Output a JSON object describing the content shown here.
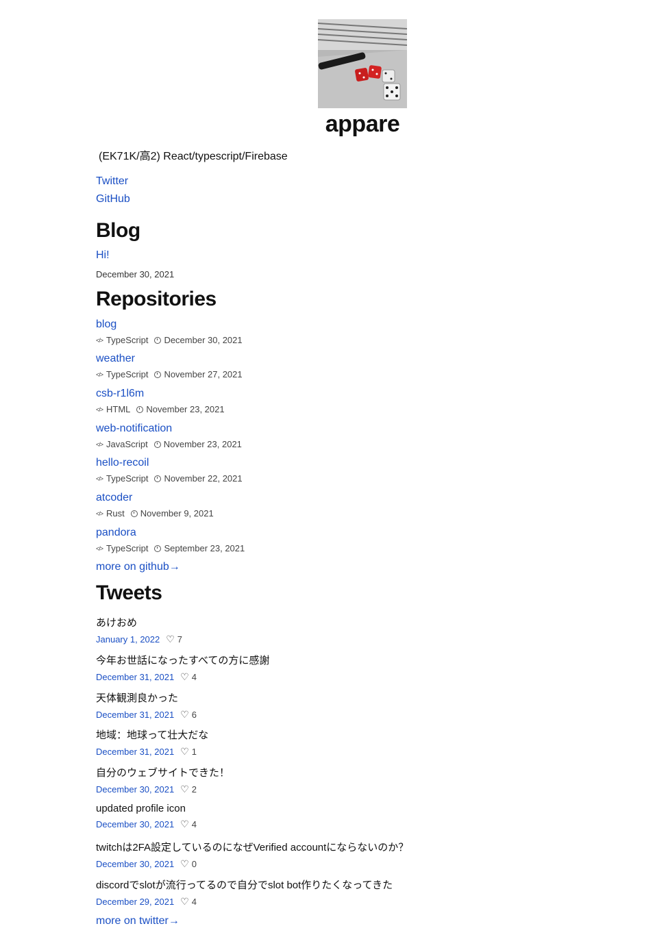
{
  "profile": {
    "name": "appare",
    "bio": "(EK71K/高2) React/typescript/Firebase",
    "links": [
      {
        "label": "Twitter"
      },
      {
        "label": "GitHub"
      }
    ]
  },
  "blog": {
    "heading": "Blog",
    "posts": [
      {
        "title": "Hi!",
        "date": "December 30, 2021"
      }
    ]
  },
  "repositories": {
    "heading": "Repositories",
    "items": [
      {
        "name": "blog",
        "language": "TypeScript",
        "date": "December 30, 2021"
      },
      {
        "name": "weather",
        "language": "TypeScript",
        "date": "November 27, 2021"
      },
      {
        "name": "csb-r1l6m",
        "language": "HTML",
        "date": "November 23, 2021"
      },
      {
        "name": "web-notification",
        "language": "JavaScript",
        "date": "November 23, 2021"
      },
      {
        "name": "hello-recoil",
        "language": "TypeScript",
        "date": "November 22, 2021"
      },
      {
        "name": "atcoder",
        "language": "Rust",
        "date": "November 9, 2021"
      },
      {
        "name": "pandora",
        "language": "TypeScript",
        "date": "September 23, 2021"
      }
    ],
    "more_label": "more on github→"
  },
  "tweets": {
    "heading": "Tweets",
    "items": [
      {
        "text": "あけおめ",
        "date": "January 1, 2022",
        "likes": "7"
      },
      {
        "text": "今年お世話になったすべての方に感謝",
        "date": "December 31, 2021",
        "likes": "4"
      },
      {
        "text": "天体観測良かった",
        "date": "December 31, 2021",
        "likes": "6"
      },
      {
        "text": "地域：地球って壮大だな",
        "date": "December 31, 2021",
        "likes": "1"
      },
      {
        "text": "自分のウェブサイトできた！",
        "date": "December 30, 2021",
        "likes": "2"
      },
      {
        "text": "updated profile icon",
        "date": "December 30, 2021",
        "likes": "4"
      },
      {
        "text": "twitchは2FA設定しているのになぜVerified accountにならないのか？",
        "date": "December 30, 2021",
        "likes": "0"
      },
      {
        "text": "discordでslotが流行ってるので自分でslot bot作りたくなってきた",
        "date": "December 29, 2021",
        "likes": "4"
      }
    ],
    "more_label": "more on twitter→"
  }
}
